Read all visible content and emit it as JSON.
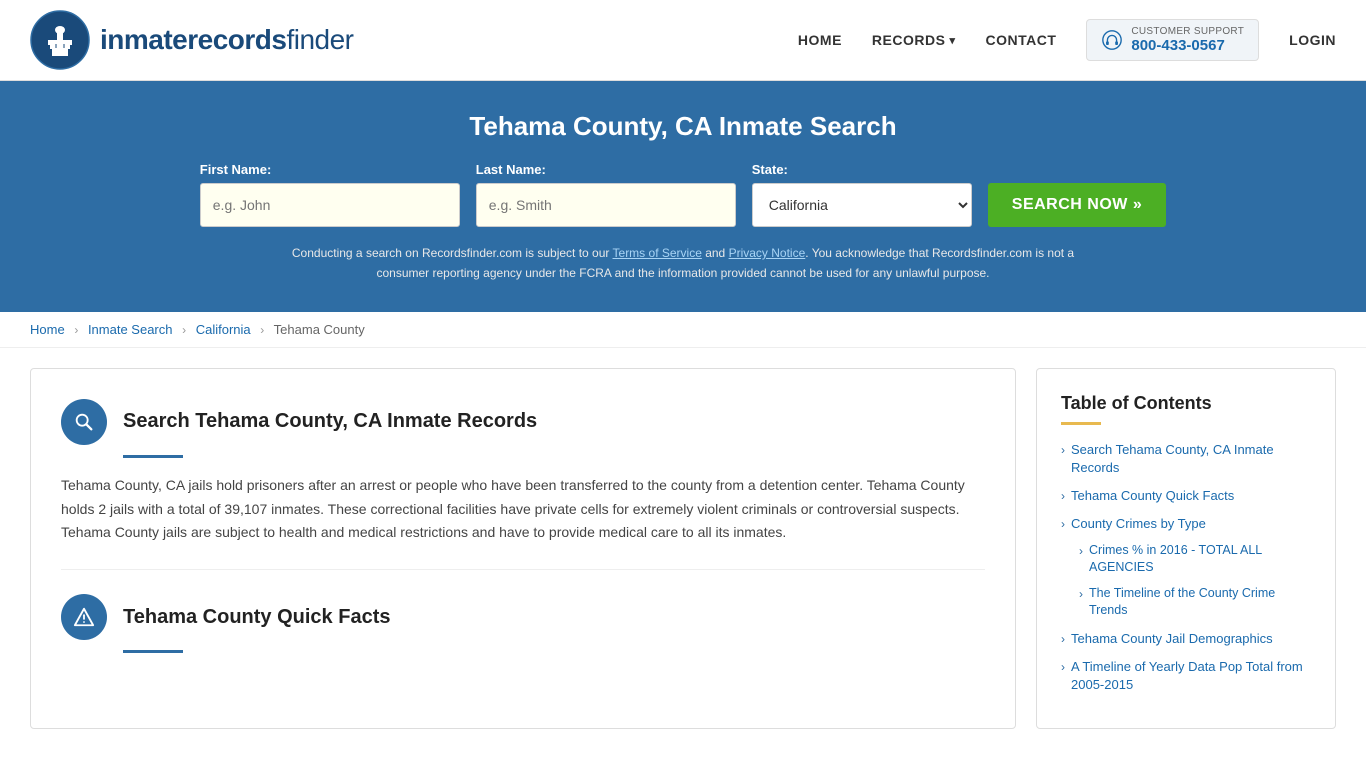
{
  "header": {
    "logo_text_light": "inmaterecords",
    "logo_text_bold": "finder",
    "nav": {
      "home_label": "HOME",
      "records_label": "RECORDS",
      "records_arrow": "▾",
      "contact_label": "CONTACT",
      "support_label": "CUSTOMER SUPPORT",
      "support_number": "800-433-0567",
      "login_label": "LOGIN"
    }
  },
  "hero": {
    "title": "Tehama County, CA Inmate Search",
    "first_name_label": "First Name:",
    "first_name_placeholder": "e.g. John",
    "last_name_label": "Last Name:",
    "last_name_placeholder": "e.g. Smith",
    "state_label": "State:",
    "state_value": "California",
    "search_button": "SEARCH NOW »",
    "legal_text": "Conducting a search on Recordsfinder.com is subject to our Terms of Service and Privacy Notice. You acknowledge that Recordsfinder.com is not a consumer reporting agency under the FCRA and the information provided cannot be used for any unlawful purpose.",
    "terms_label": "Terms of Service",
    "privacy_label": "Privacy Notice"
  },
  "breadcrumb": {
    "items": [
      {
        "label": "Home",
        "link": true
      },
      {
        "label": "Inmate Search",
        "link": true
      },
      {
        "label": "California",
        "link": true
      },
      {
        "label": "Tehama County",
        "link": false
      }
    ]
  },
  "main": {
    "section1": {
      "title": "Search Tehama County, CA Inmate Records",
      "body": "Tehama County, CA jails hold prisoners after an arrest or people who have been transferred to the county from a detention center. Tehama County holds 2 jails with a total of 39,107 inmates. These correctional facilities have private cells for extremely violent criminals or controversial suspects. Tehama County jails are subject to health and medical restrictions and have to provide medical care to all its inmates."
    },
    "section2": {
      "title": "Tehama County Quick Facts"
    }
  },
  "toc": {
    "title": "Table of Contents",
    "items": [
      {
        "label": "Search Tehama County, CA Inmate Records",
        "sub": []
      },
      {
        "label": "Tehama County Quick Facts",
        "sub": []
      },
      {
        "label": "County Crimes by Type",
        "sub": [
          {
            "label": "Crimes % in 2016 - TOTAL ALL AGENCIES"
          },
          {
            "label": "The Timeline of the County Crime Trends"
          }
        ]
      },
      {
        "label": "Tehama County Jail Demographics",
        "sub": []
      },
      {
        "label": "A Timeline of Yearly Data Pop Total from 2005-2015",
        "sub": []
      }
    ]
  }
}
